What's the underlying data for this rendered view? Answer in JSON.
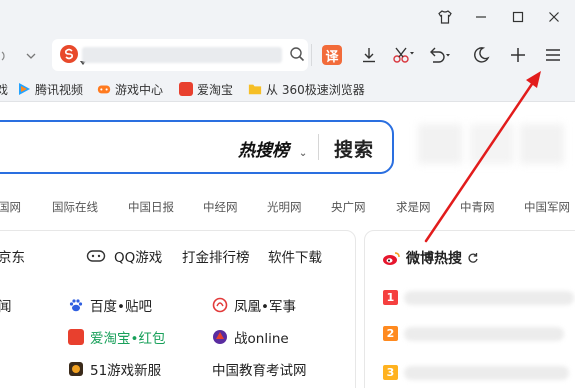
{
  "titlebar": {
    "icons": [
      "shirt-icon",
      "minimize-icon",
      "maximize-icon",
      "close-icon"
    ]
  },
  "toolbar": {
    "translate_label": "译",
    "icons": [
      "download-icon",
      "scissors-icon",
      "undo-icon",
      "moon-icon",
      "plus-icon",
      "menu-icon"
    ]
  },
  "bookmarks": [
    {
      "label": "戏"
    },
    {
      "label": "腾讯视频"
    },
    {
      "label": "游戏中心"
    },
    {
      "label": "爱淘宝"
    },
    {
      "label": "从 360极速浏览器"
    }
  ],
  "search": {
    "hot_label": "热搜榜",
    "button_label": "搜索"
  },
  "news_links": [
    "国网",
    "国际在线",
    "中国日报",
    "中经网",
    "光明网",
    "央广网",
    "求是网",
    "中青网",
    "中国军网"
  ],
  "quick_links": {
    "jd": "京东",
    "qqgame": "QQ游戏",
    "ranking": "打金排行榜",
    "software": "软件下载"
  },
  "sites": {
    "row1": {
      "c0": "闻",
      "c1": "百度•贴吧",
      "c2": "凤凰•军事"
    },
    "row2": {
      "c0": "",
      "c1a": "爱淘宝",
      "c1b": "•红包",
      "c2": "战online"
    },
    "row3": {
      "c0": "",
      "c1": "51游戏新服",
      "c2": "中国教育考试网"
    }
  },
  "weibo": {
    "title": "微博热搜",
    "ranks": [
      "1",
      "2",
      "3"
    ]
  },
  "colors": {
    "accent_blue": "#2a6fe0",
    "rank1": "#f5403f",
    "rank2": "#ff8a1f",
    "rank3": "#ffb21f",
    "arrow_red": "#e21c1c",
    "taobao_green": "#18a05a"
  }
}
